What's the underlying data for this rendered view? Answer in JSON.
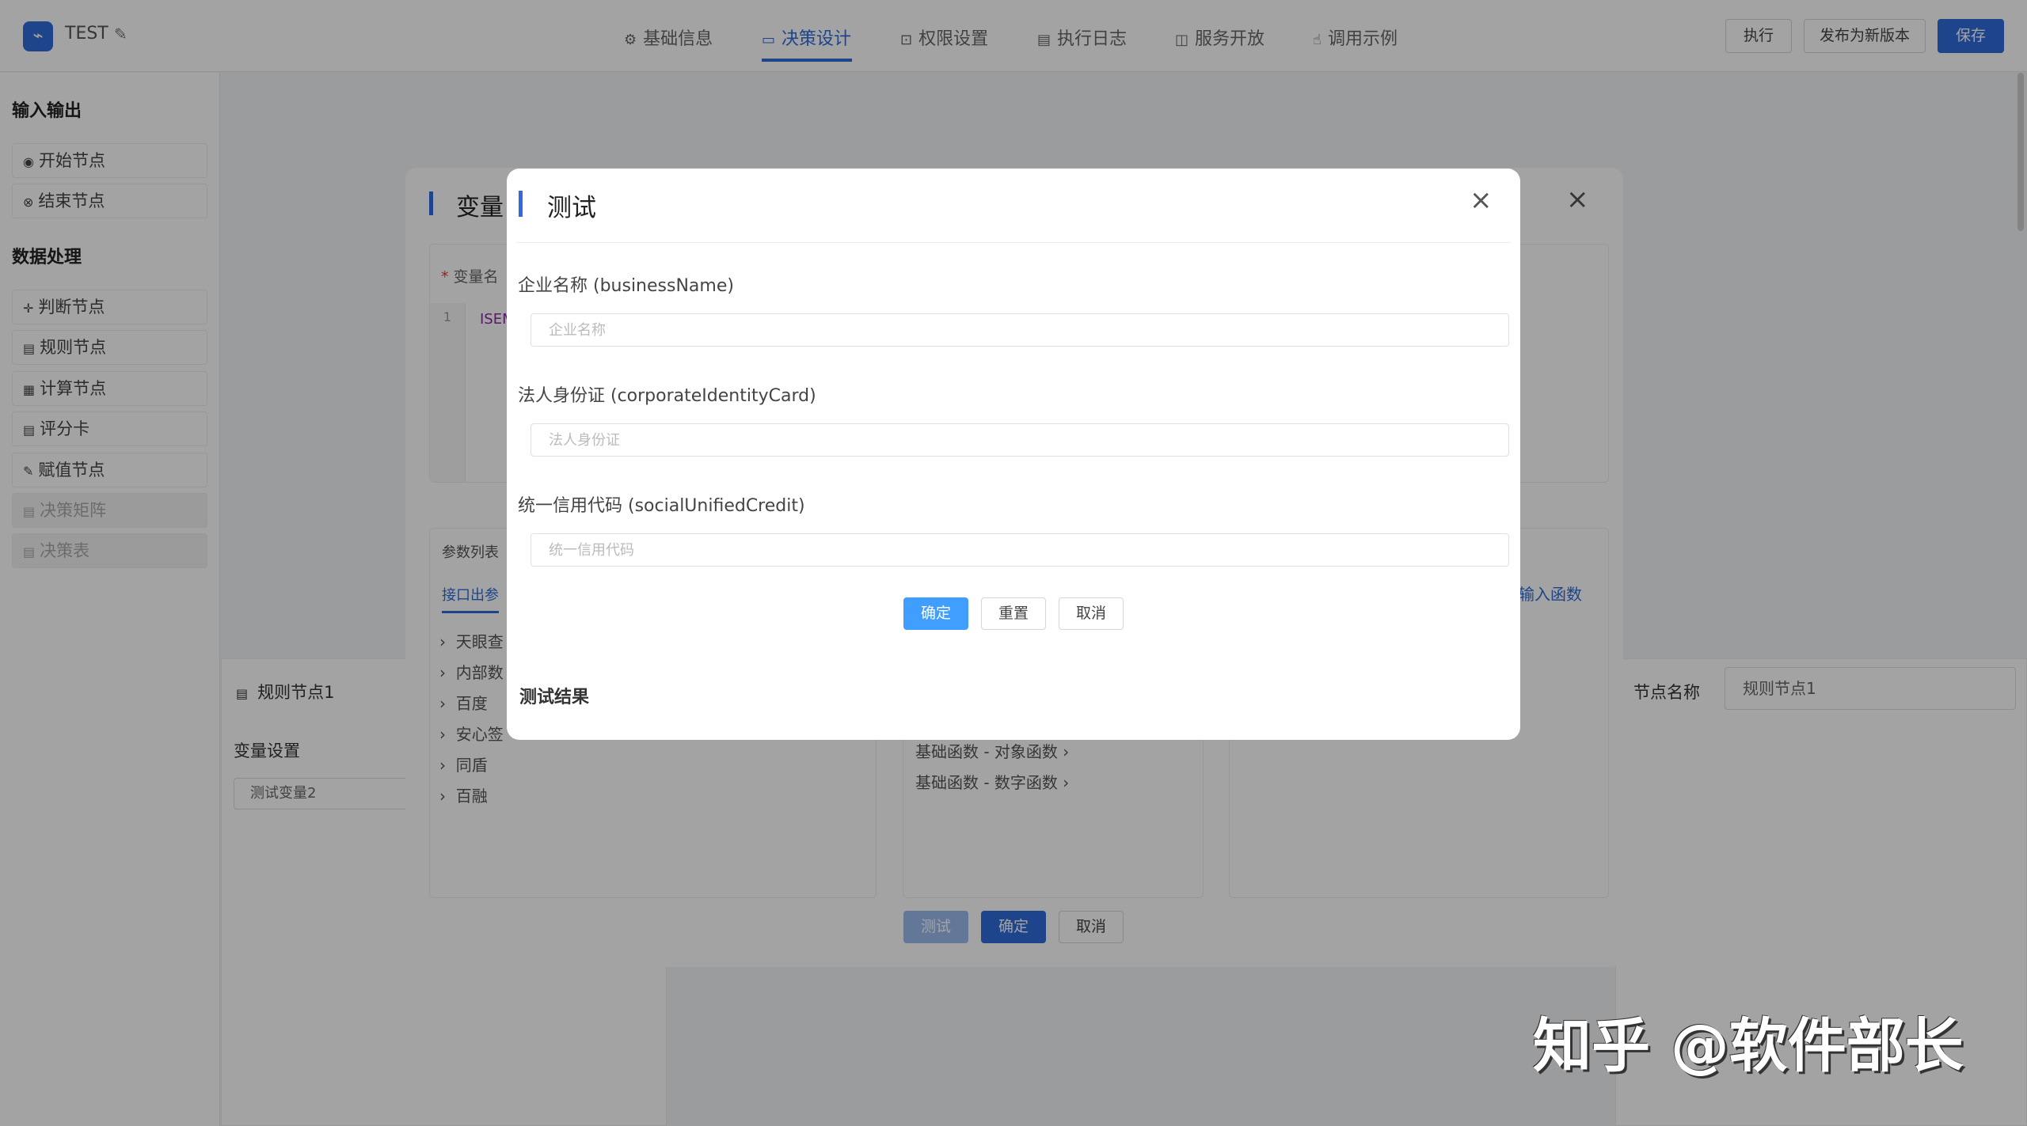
{
  "header": {
    "app_title": "TEST",
    "tabs": [
      {
        "label": "基础信息",
        "icon": "gear-icon"
      },
      {
        "label": "决策设计",
        "icon": "design-icon"
      },
      {
        "label": "权限设置",
        "icon": "lock-icon"
      },
      {
        "label": "执行日志",
        "icon": "document-icon"
      },
      {
        "label": "服务开放",
        "icon": "book-icon"
      },
      {
        "label": "调用示例",
        "icon": "hand-icon"
      }
    ],
    "active_tab": "决策设计",
    "buttons": {
      "run": "执行",
      "publish": "发布为新版本",
      "save": "保存"
    }
  },
  "sidebar": {
    "group_io": "输入输出",
    "io_items": [
      {
        "label": "开始节点",
        "icon": "play-circle-icon"
      },
      {
        "label": "结束节点",
        "icon": "stop-circle-icon"
      }
    ],
    "group_data": "数据处理",
    "data_items": [
      {
        "label": "判断节点",
        "icon": "cross-move-icon",
        "disabled": false
      },
      {
        "label": "规则节点",
        "icon": "table-icon",
        "disabled": false
      },
      {
        "label": "计算节点",
        "icon": "calculator-icon",
        "disabled": false
      },
      {
        "label": "评分卡",
        "icon": "card-icon",
        "disabled": false
      },
      {
        "label": "赋值节点",
        "icon": "edit-icon",
        "disabled": false
      },
      {
        "label": "决策矩阵",
        "icon": "table-icon",
        "disabled": true
      },
      {
        "label": "决策表",
        "icon": "table-icon",
        "disabled": true
      }
    ]
  },
  "background": {
    "node_label": "规则节点1",
    "variable_settings": "变量设置",
    "variable_item": "测试变量2",
    "node_name_label": "节点名称",
    "node_name_value": "规则节点1",
    "variable_dialog": {
      "title": "变量",
      "field_label": "变量名",
      "code_line": "1",
      "code_text": "ISEM",
      "param_list": "参数列表",
      "interface_tab": "接口出参",
      "tree_items": [
        "天眼查",
        "内部数",
        "百度",
        "安心签",
        "同盾",
        "百融"
      ],
      "functions": [
        "基础函数 - 对象函数",
        "基础函数 - 数字函数"
      ],
      "input_function": "输入函数",
      "buttons": {
        "test": "测试",
        "confirm": "确定",
        "cancel": "取消"
      }
    }
  },
  "modal": {
    "title": "测试",
    "fields": [
      {
        "label": "企业名称 (businessName)",
        "placeholder": "企业名称",
        "value": ""
      },
      {
        "label": "法人身份证 (corporateIdentityCard)",
        "placeholder": "法人身份证",
        "value": ""
      },
      {
        "label": "统一信用代码 (socialUnifiedCredit)",
        "placeholder": "统一信用代码",
        "value": ""
      }
    ],
    "buttons": {
      "confirm": "确定",
      "reset": "重置",
      "cancel": "取消"
    },
    "result_label": "测试结果"
  },
  "watermark": "知乎 @软件部长",
  "colors": {
    "accent": "#2f6bdc",
    "primary_button": "#409eff"
  }
}
